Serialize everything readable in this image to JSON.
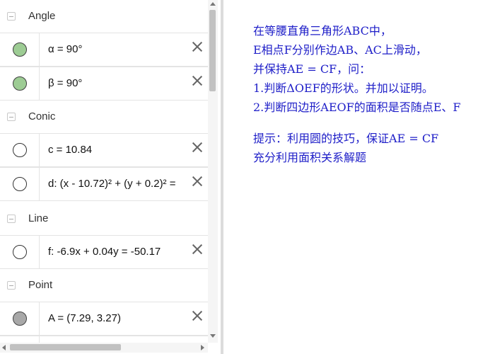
{
  "algebra": {
    "groups": [
      {
        "label": "Angle"
      },
      {
        "label": "Conic"
      },
      {
        "label": "Line"
      },
      {
        "label": "Point"
      }
    ],
    "items": [
      {
        "expr": "α = 90°",
        "visible": true
      },
      {
        "expr": "β = 90°",
        "visible": true
      },
      {
        "expr": "c = 10.84",
        "visible": false
      },
      {
        "expr": "d: (x - 10.72)² + (y + 0.2)² =",
        "visible": false
      },
      {
        "expr": "f: -6.9x + 0.04y = -50.17",
        "visible": false
      },
      {
        "expr": "A = (7.29, 3.27)",
        "visible": true
      }
    ]
  },
  "graphics": {
    "lines": [
      "在等腰直角三角形ABC中，",
      "E相点F分别作边AB、AC上滑动，",
      "并保持AE = CF，问：",
      "1.判断ΔOEF的形状。并加以证明。",
      "2.判断四边形AEOF的面积是否随点E、F",
      "提示：利用圆的技巧，保证AE = CF",
      "充分利用面积关系解题"
    ]
  },
  "colors": {
    "marble_green": "#9dcc94",
    "marble_gray": "#a8a8a8",
    "text_blue": "#1e1ec8"
  },
  "icons": {
    "collapse": "minus-square-icon",
    "delete": "close-icon"
  }
}
